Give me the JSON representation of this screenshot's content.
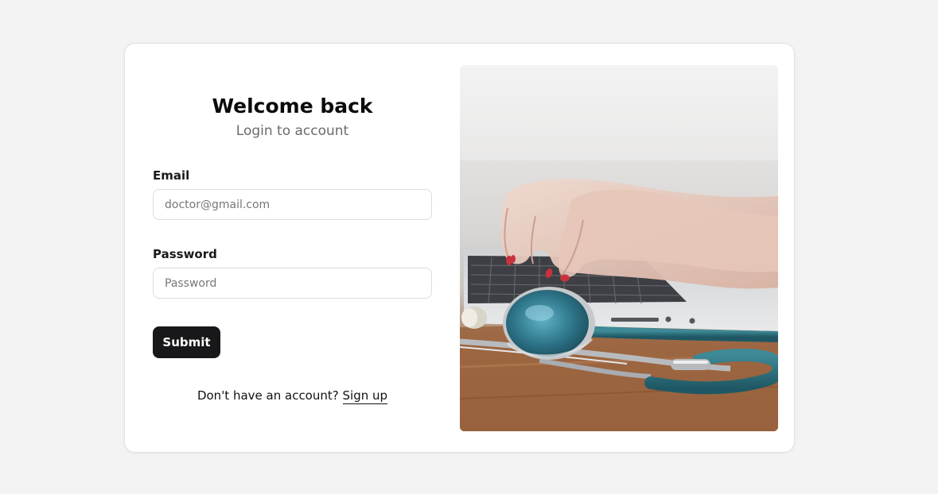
{
  "login": {
    "title": "Welcome back",
    "subtitle": "Login to account",
    "email_label": "Email",
    "email_placeholder": "doctor@gmail.com",
    "email_value": "",
    "password_label": "Password",
    "password_placeholder": "Password",
    "password_value": "",
    "submit_label": "Submit",
    "signup_prompt": "Don't have an account?",
    "signup_link": "Sign up"
  },
  "hero_image": {
    "alt": "Hands typing on a laptop with a stethoscope on a wooden desk"
  },
  "colors": {
    "page_background": "#f3f3f3",
    "card_background": "#ffffff",
    "primary_button": "#18181a",
    "muted_text": "#6b6b6b"
  }
}
